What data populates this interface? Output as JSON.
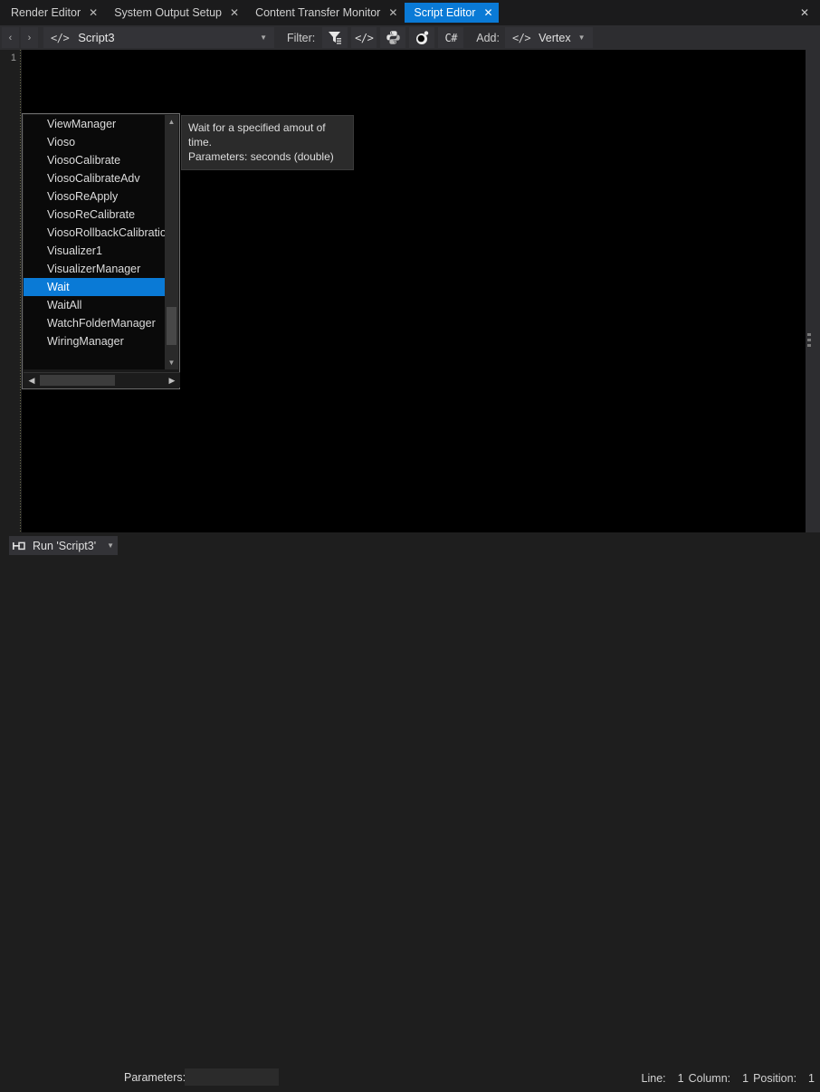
{
  "window": {
    "close_label": "✕"
  },
  "tabs": [
    {
      "label": "Render Editor",
      "close": "✕",
      "active": false
    },
    {
      "label": "System Output Setup",
      "close": "✕",
      "active": false
    },
    {
      "label": "Content Transfer Monitor",
      "close": "✕",
      "active": false
    },
    {
      "label": "Script Editor",
      "close": "✕",
      "active": true
    }
  ],
  "toolbar": {
    "nav_back": "‹",
    "nav_forward": "›",
    "script_code_icon": "</>",
    "script_name": "Script3",
    "script_caret": "▼",
    "filter_label": "Filter:",
    "filter_icon": "filter-icon",
    "buttons": [
      {
        "name": "filter-button",
        "glyph": "ᵛ"
      },
      {
        "name": "code-filter-button",
        "glyph": "</>"
      },
      {
        "name": "python-filter-button",
        "glyph": "py"
      },
      {
        "name": "ruby-filter-button",
        "glyph": "rb"
      },
      {
        "name": "csharp-filter-button",
        "glyph": "C#"
      }
    ],
    "add_label": "Add:",
    "add_code_icon": "</>",
    "add_value": "Vertex",
    "add_caret": "▼"
  },
  "editor": {
    "line_numbers": [
      "1"
    ]
  },
  "autocomplete": {
    "items": [
      "ViewManager",
      "Vioso",
      "ViosoCalibrate",
      "ViosoCalibrateAdv",
      "ViosoReApply",
      "ViosoReCalibrate",
      "ViosoRollbackCalibration",
      "Visualizer1",
      "VisualizerManager",
      "Wait",
      "WaitAll",
      "WatchFolderManager",
      "WiringManager"
    ],
    "selected_index": 9,
    "scroll_up": "▲",
    "scroll_down": "▼",
    "scroll_left": "◀",
    "scroll_right": "▶"
  },
  "tooltip": {
    "line1": "Wait for a specified amout of time.",
    "line2": "Parameters: seconds (double)"
  },
  "statusbar": {
    "run_icon": "run-pin-icon",
    "run_label": "Run 'Script3'",
    "run_caret": "▼",
    "params_label": "Parameters:",
    "params_value": "",
    "params_placeholder": "",
    "line_label": "Line:",
    "line_value": "1",
    "column_label": "Column:",
    "column_value": "1",
    "position_label": "Position:",
    "position_value": "1"
  },
  "colors": {
    "accent": "#0a7ad6",
    "toolbar_bg": "#2d2d30",
    "editor_bg": "#000000",
    "chrome_bg": "#1e1e1e"
  }
}
